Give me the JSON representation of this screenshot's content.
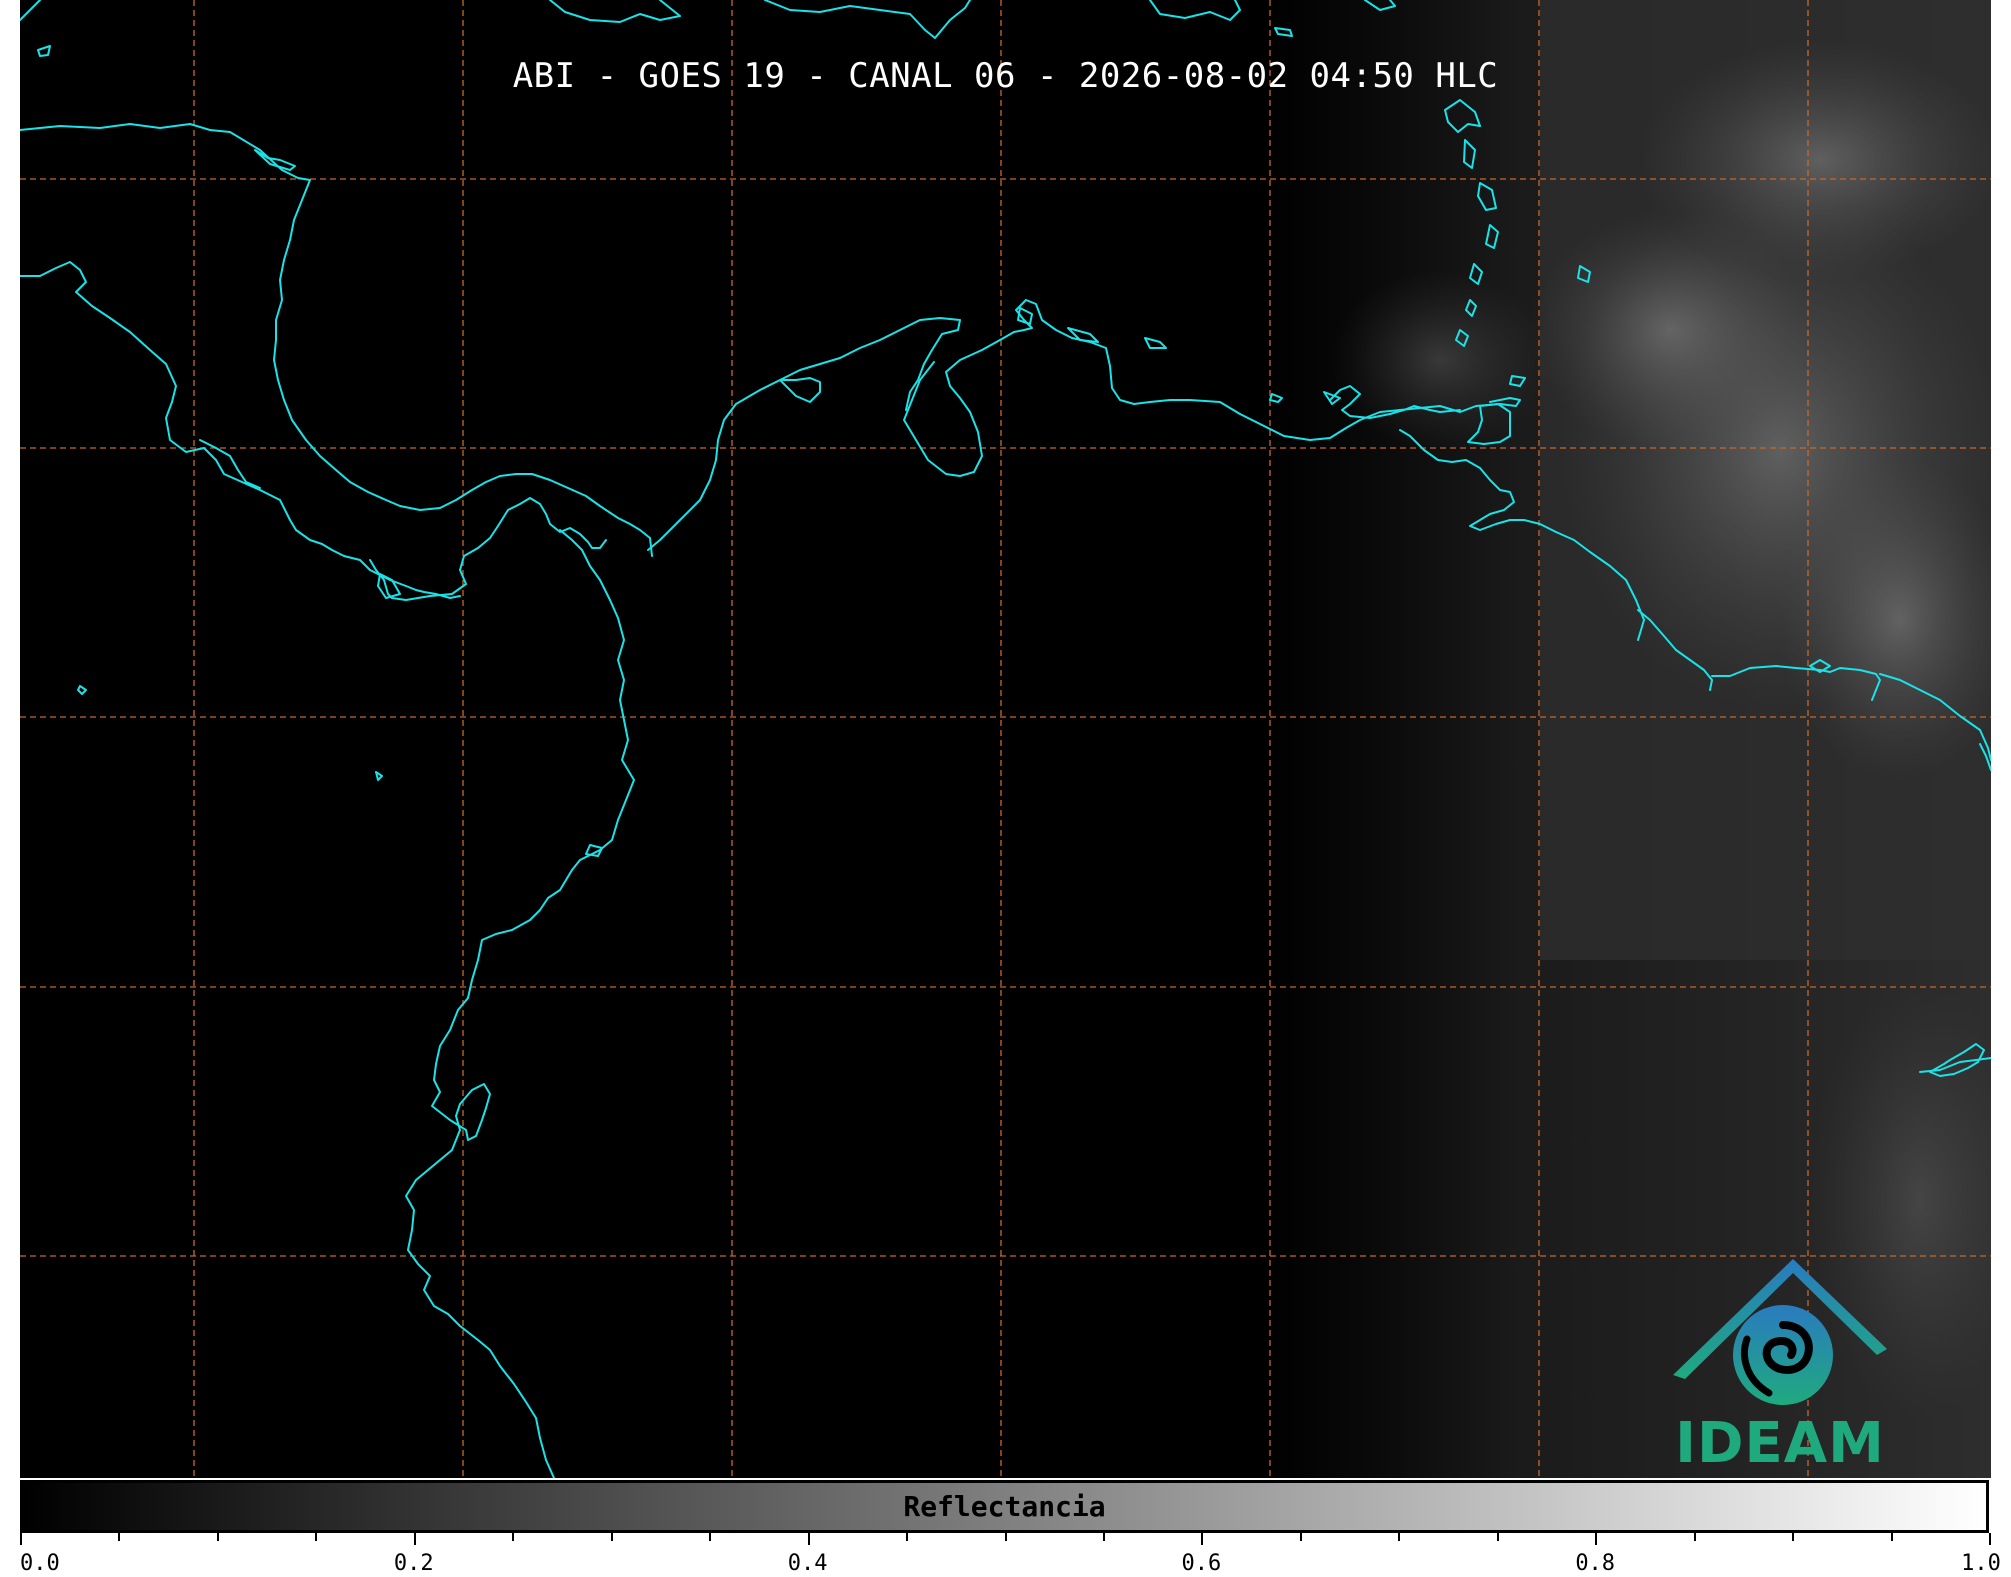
{
  "title": "ABI - GOES 19 - CANAL 06 - 2026-08-02 04:50 HLC",
  "map": {
    "background": "#000000",
    "coastline_color": "#19e3e8",
    "gridline_color": "#c8682a",
    "gridline_style": "dashed",
    "cloud_region": "east"
  },
  "colorbar": {
    "label": "Reflectancia",
    "range": [
      0.0,
      1.0
    ],
    "tick_labels": [
      "0.0",
      "0.2",
      "0.4",
      "0.6",
      "0.8",
      "1.0"
    ],
    "gradient": [
      "#000000",
      "#ffffff"
    ]
  },
  "logo": {
    "text": "IDEAM",
    "colors": [
      "#2a7bbf",
      "#1faa7e"
    ]
  }
}
